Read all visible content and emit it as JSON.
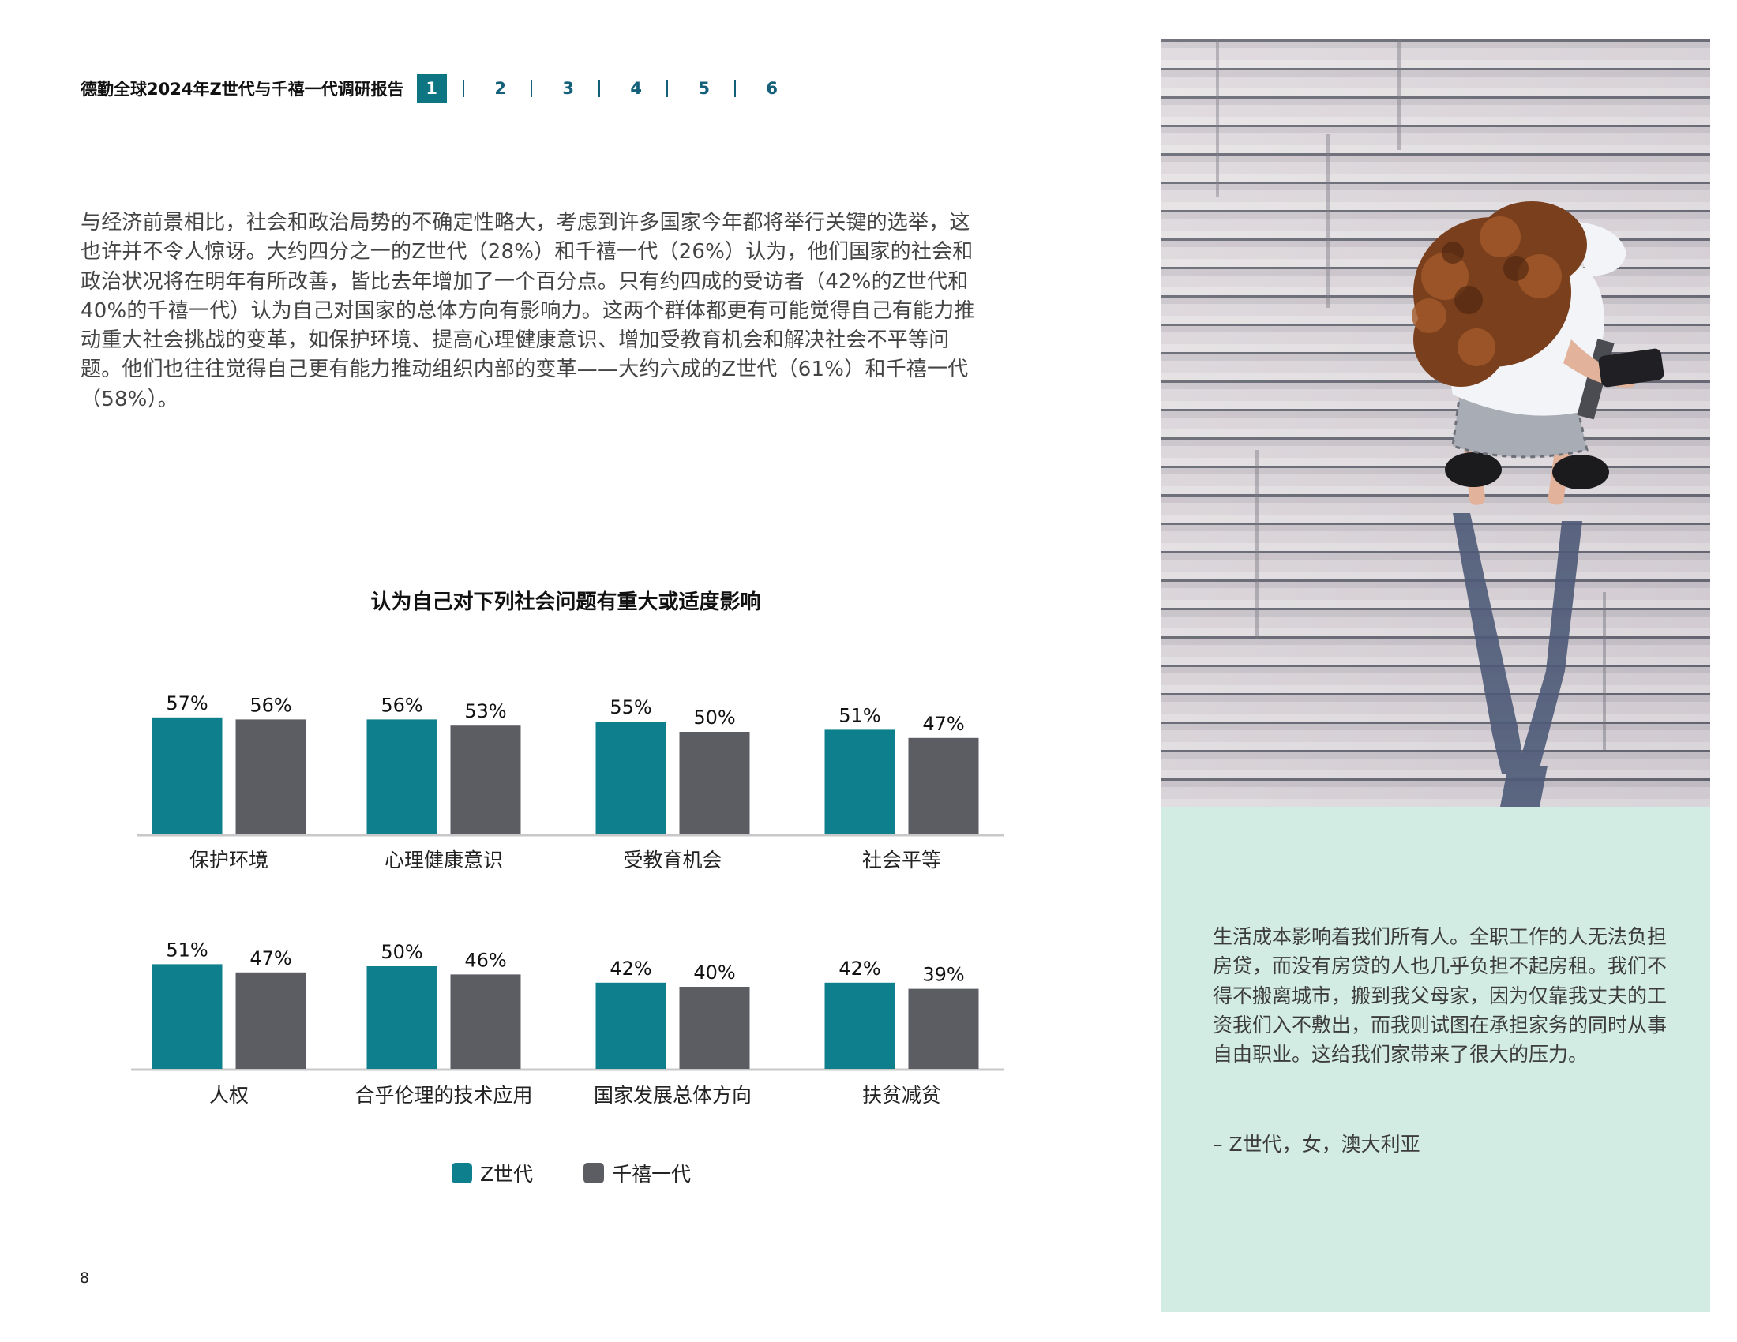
{
  "header": {
    "report_title": "德勤全球2024年Z世代与千禧一代调研报告",
    "pages": [
      "1",
      "2",
      "3",
      "4",
      "5",
      "6"
    ],
    "active_page": "1"
  },
  "intro_text": "与经济前景相比，社会和政治局势的不确定性略大，考虑到许多国家今年都将举行关键的选举，这也许并不令人惊讶。大约四分之一的Z世代（28%）和千禧一代（26%）认为，他们国家的社会和政治状况将在明年有所改善，皆比去年增加了一个百分点。只有约四成的受访者（42%的Z世代和40%的千禧一代）认为自己对国家的总体方向有影响力。这两个群体都更有可能觉得自己有能力推动重大社会挑战的变革，如保护环境、提高心理健康意识、增加受教育机会和解决社会不平等问题。他们也往往觉得自己更有能力推动组织内部的变革——大约六成的Z世代（61%）和千禧一代（58%）。",
  "chart_data": {
    "type": "bar",
    "title": "认为自己对下列社会问题有重大或适度影响",
    "categories": [
      "保护环境",
      "心理健康意识",
      "受教育机会",
      "社会平等",
      "人权",
      "合乎伦理的技术应用",
      "国家发展总体方向",
      "扶贫减贫"
    ],
    "series": [
      {
        "name": "Z世代",
        "values": [
          57,
          56,
          55,
          51,
          51,
          50,
          42,
          42
        ],
        "labels": [
          "57%",
          "56%",
          "55%",
          "51%",
          "51%",
          "50%",
          "42%",
          "42%"
        ],
        "color": "#0e7f8c"
      },
      {
        "name": "千禧一代",
        "values": [
          56,
          53,
          50,
          47,
          47,
          46,
          40,
          39
        ],
        "labels": [
          "56%",
          "53%",
          "50%",
          "47%",
          "47%",
          "46%",
          "40%",
          "39%"
        ],
        "color": "#5b5d63"
      }
    ],
    "unit": "%",
    "legend_position": "bottom",
    "grid": false
  },
  "page_number": "8",
  "quote": {
    "text": "生活成本影响着我们所有人。全职工作的人无法负担房贷，而没有房贷的人也几乎负担不起房租。我们不得不搬离城市，搬到我父母家，因为仅靠我丈夫的工资我们入不敷出，而我则试图在承担家务的同时从事自由职业。这给我们家带来了很大的压力。",
    "attribution": "– Z世代，女，澳大利亚"
  },
  "colors": {
    "teal": "#0e7f8c",
    "gray": "#5b5d63",
    "mint_panel": "#d2ebe3",
    "nav_blue": "#14607a"
  },
  "photo": {
    "icon": "woman-walking-on-boardwalk-photo"
  }
}
